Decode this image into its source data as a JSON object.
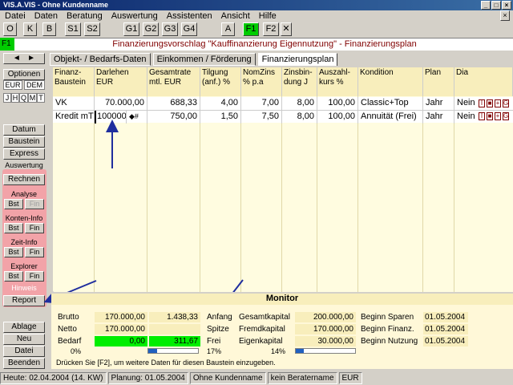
{
  "window": {
    "title": "VIS.A.VIS - Ohne Kundenname"
  },
  "menu": [
    "Datei",
    "Daten",
    "Beratung",
    "Auswertung",
    "Assistenten",
    "Ansicht",
    "Hilfe"
  ],
  "toolbar": {
    "buttons": [
      "O",
      "K",
      "B",
      "S1",
      "S2",
      "G1",
      "G2",
      "G3",
      "G4",
      "A",
      "F1",
      "F2"
    ],
    "close": "✕"
  },
  "header": {
    "badge": "F1",
    "title": "Finanzierungsvorschlag \"Kauffinanzierung Eigennutzung\" - Finanzierungsplan"
  },
  "sidebar": {
    "optionen": "Optionen",
    "currencies": [
      "EUR",
      "DEM"
    ],
    "periods": [
      "J",
      "H",
      "Q",
      "M",
      "T"
    ],
    "datum": "Datum",
    "baustein": "Baustein",
    "express": "Express",
    "auswertung": "Auswertung",
    "rechnen": "Rechnen",
    "analyse": "Analyse",
    "konteninfo": "Konten-Info",
    "zeitinfo": "Zeit-Info",
    "explorer": "Explorer",
    "bst": "Bst",
    "fin": "Fin",
    "hinweis": "Hinweis",
    "report": "Report",
    "ablage": "Ablage",
    "neu": "Neu",
    "datei": "Datei",
    "beenden": "Beenden"
  },
  "tabs": [
    "Objekt- / Bedarfs-Daten",
    "Einkommen / Förderung",
    "Finanzierungsplan"
  ],
  "columns": [
    [
      "Finanz-",
      "Baustein"
    ],
    [
      "Darlehen",
      "EUR"
    ],
    [
      "Gesamtrate",
      "mtl. EUR"
    ],
    [
      "Tilgung",
      "(anf.) %"
    ],
    [
      "NomZins",
      "% p.a"
    ],
    [
      "Zinsbin-",
      "dung J"
    ],
    [
      "Auszahl-",
      "kurs %"
    ],
    [
      "Kondition",
      ""
    ],
    [
      "Plan",
      ""
    ],
    [
      "Dia",
      ""
    ]
  ],
  "rows": [
    [
      "VK",
      "70.000,00",
      "688,33",
      "4,00",
      "7,00",
      "8,00",
      "100,00",
      "Classic+Top",
      "Jahr",
      "Nein"
    ],
    [
      "Kredit mT",
      "100000",
      "750,00",
      "1,50",
      "7,50",
      "8,00",
      "100,00",
      "Annuität  (Frei)",
      "Jahr",
      "Nein"
    ]
  ],
  "row_symbol": "◆#",
  "row_buttons": [
    "I",
    "■",
    "+",
    "G"
  ],
  "monitor": {
    "title": "Monitor",
    "labels": [
      "Brutto",
      "Netto",
      "Bedarf"
    ],
    "col1": [
      "170.000,00",
      "170.000,00",
      "0,00"
    ],
    "col2": [
      "1.438,33",
      "",
      "311,67"
    ],
    "pct1": "0%",
    "pct2": "17%",
    "pct2_fill": 0.17,
    "mid_labels": [
      "Anfang",
      "Spitze",
      "Frei"
    ],
    "cap_labels": [
      "Gesamtkapital",
      "Fremdkapital",
      "Eigenkapital"
    ],
    "cap_values": [
      "200.000,00",
      "170.000,00",
      "30.000,00"
    ],
    "pct3": "14%",
    "pct3_fill": 0.14,
    "begin_labels": [
      "Beginn Sparen",
      "Beginn Finanz.",
      "Beginn Nutzung"
    ],
    "begin_values": [
      "01.05.2004",
      "01.05.2004",
      "01.05.2004"
    ],
    "hint": "Drücken Sie [F2], um weitere Daten für diesen Baustein einzugeben."
  },
  "statusbar": [
    "Heute: 02.04.2004 (14. KW)",
    "Planung: 01.05.2004",
    "Ohne Kundenname",
    "kein Beratername",
    "EUR"
  ],
  "colors": {
    "accent_green": "#00cc00",
    "title_red": "#800000",
    "group_pink": "#f2a3a8",
    "arrow_blue": "#1f2e9e"
  }
}
